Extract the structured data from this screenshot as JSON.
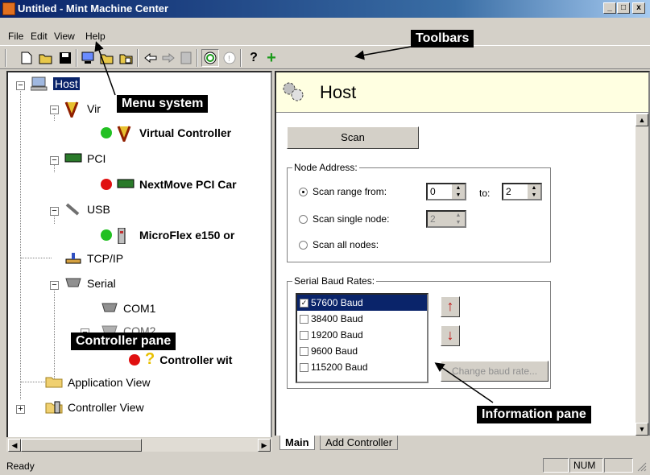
{
  "window": {
    "title": "Untitled - Mint Machine Center",
    "minimize": "_",
    "maximize": "□",
    "close": "x"
  },
  "menu": {
    "file": "File",
    "edit": "Edit",
    "view": "View",
    "help": "Help"
  },
  "tree": {
    "host": "Host",
    "virtual": "Vir",
    "virtual_controller": "Virtual Controller",
    "pci": "PCI",
    "nextmove": "NextMove PCI Car",
    "usb": "USB",
    "microflex": "MicroFlex e150 or",
    "tcpip": "TCP/IP",
    "serial": "Serial",
    "com1": "COM1",
    "com2": "COM2",
    "controller_wit": "Controller wit",
    "application_view": "Application View",
    "controller_view": "Controller View"
  },
  "info": {
    "title": "Host",
    "scan_button": "Scan",
    "node_address_legend": "Node Address:",
    "scan_range_label": "Scan range from:",
    "range_from": "0",
    "to_label": "to:",
    "range_to": "2",
    "scan_single_label": "Scan single node:",
    "single_value": "2",
    "scan_all_label": "Scan all nodes:",
    "baud_legend": "Serial Baud Rates:",
    "baud_rates": [
      "57600 Baud",
      "38400 Baud",
      "19200 Baud",
      "9600 Baud",
      "115200 Baud"
    ],
    "change_baud_button": "Change baud rate..."
  },
  "tabs": {
    "main": "Main",
    "add_controller": "Add Controller"
  },
  "status": {
    "text": "Ready",
    "num": "NUM"
  },
  "callouts": {
    "toolbars": "Toolbars",
    "menu_system": "Menu system",
    "controller_pane": "Controller pane",
    "information_pane": "Information pane"
  },
  "colors": {
    "titlebar": "#0a246a",
    "status_green": "#22c022",
    "status_red": "#e01010",
    "selection": "#0a246a",
    "header_bg": "#ffffe1"
  }
}
